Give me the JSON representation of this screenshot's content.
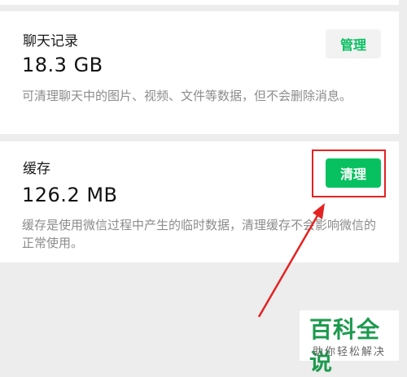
{
  "chat_records": {
    "title": "聊天记录",
    "size": "18.3 GB",
    "description": "可清理聊天中的图片、视频、文件等数据，但不会删除消息。",
    "button": "管理"
  },
  "cache": {
    "title": "缓存",
    "size": "126.2 MB",
    "description": "缓存是使用微信过程中产生的临时数据，清理缓存不会影响微信的正常使用。",
    "button": "清理"
  },
  "watermark": {
    "main": "百科全说",
    "sub": "助你轻松解决"
  },
  "colors": {
    "accent": "#07c160",
    "annotation": "#e52222",
    "background": "#ededed"
  }
}
